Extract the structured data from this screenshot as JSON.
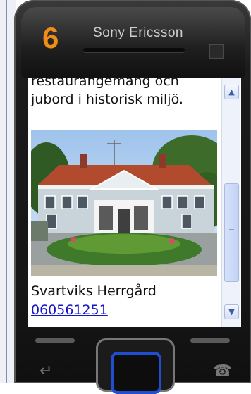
{
  "tutorial": {
    "step_number": "6"
  },
  "phone": {
    "brand": "Sony Ericsson"
  },
  "screen": {
    "description": "restaurangemang och jubord i historisk miljö.",
    "place_name": "Svartviks Herrgård",
    "phone_number": "060561251"
  },
  "scrollbar": {
    "up_icon": "chevron-up-icon",
    "down_icon": "chevron-down-icon",
    "position": 0.6
  },
  "colors": {
    "step_number": "#f08c18",
    "link": "#1515c8",
    "nav_key": "#1f4ed0"
  }
}
